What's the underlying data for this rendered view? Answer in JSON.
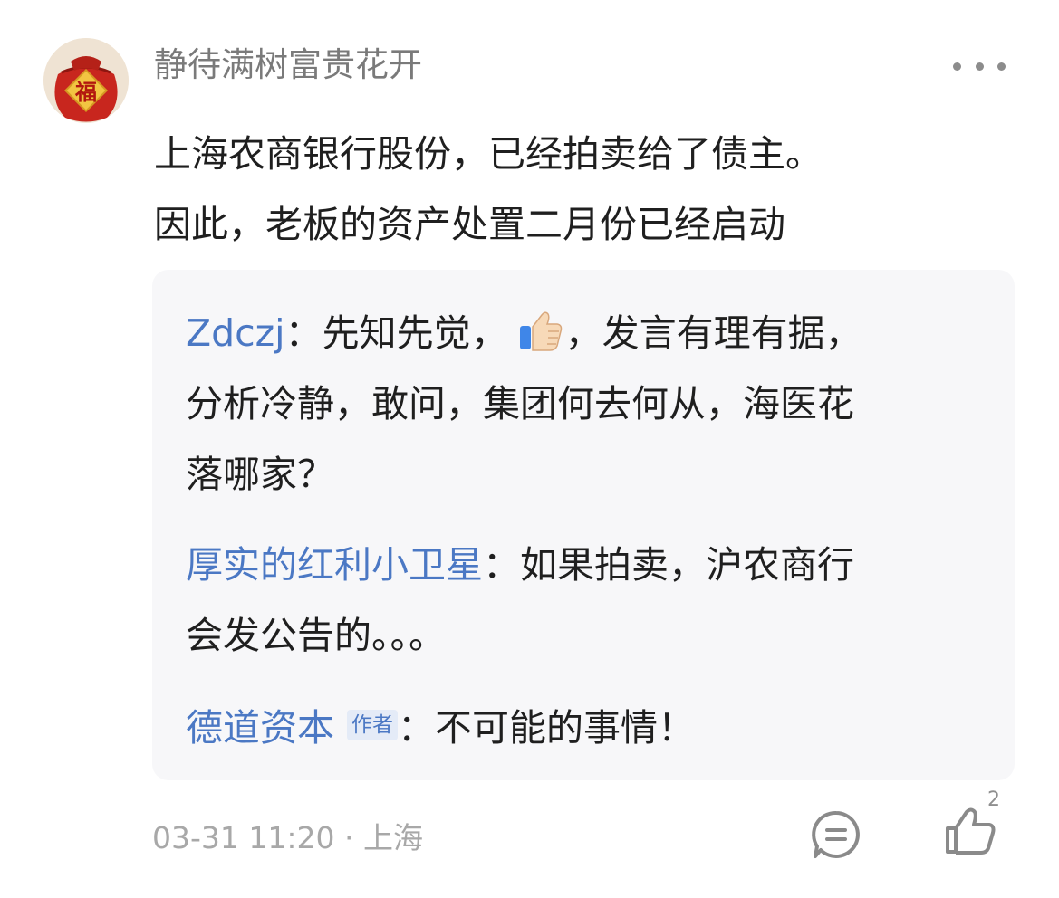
{
  "post": {
    "username": "静待满树富贵花开",
    "avatar_icon": "fortune-bag-icon",
    "avatar_char": "福",
    "lines": [
      "上海农商银行股份，已经拍卖给了债主。",
      "因此，老板的资产处置二月份已经启动"
    ]
  },
  "replies": [
    {
      "author": "Zdczj",
      "separator": "：",
      "line1_before_emoji": "先知先觉，",
      "emoji": "thumbs-up-emoji",
      "line1_after_emoji": "，发言有理有据，",
      "line2": "分析冷静，敢问，集团何去何从，海医花",
      "line3": "落哪家？"
    },
    {
      "author": "厚实的红利小卫星",
      "separator": "：",
      "line1": "如果拍卖，沪农商行",
      "line2": "会发公告的。。。"
    },
    {
      "author": "德道资本",
      "tag": "作者",
      "separator": "：",
      "text": "不可能的事情！"
    }
  ],
  "footer": {
    "meta": "03-31 11:20 · 上海",
    "like_count": "2",
    "comment_icon": "comment-icon",
    "like_icon": "thumbs-up-icon",
    "more_icon": "more-dots-icon"
  },
  "colors": {
    "link": "#4b78c4",
    "text": "#1f1f1f",
    "muted": "#a8a8a8",
    "reply_bg": "#f7f7f9"
  }
}
